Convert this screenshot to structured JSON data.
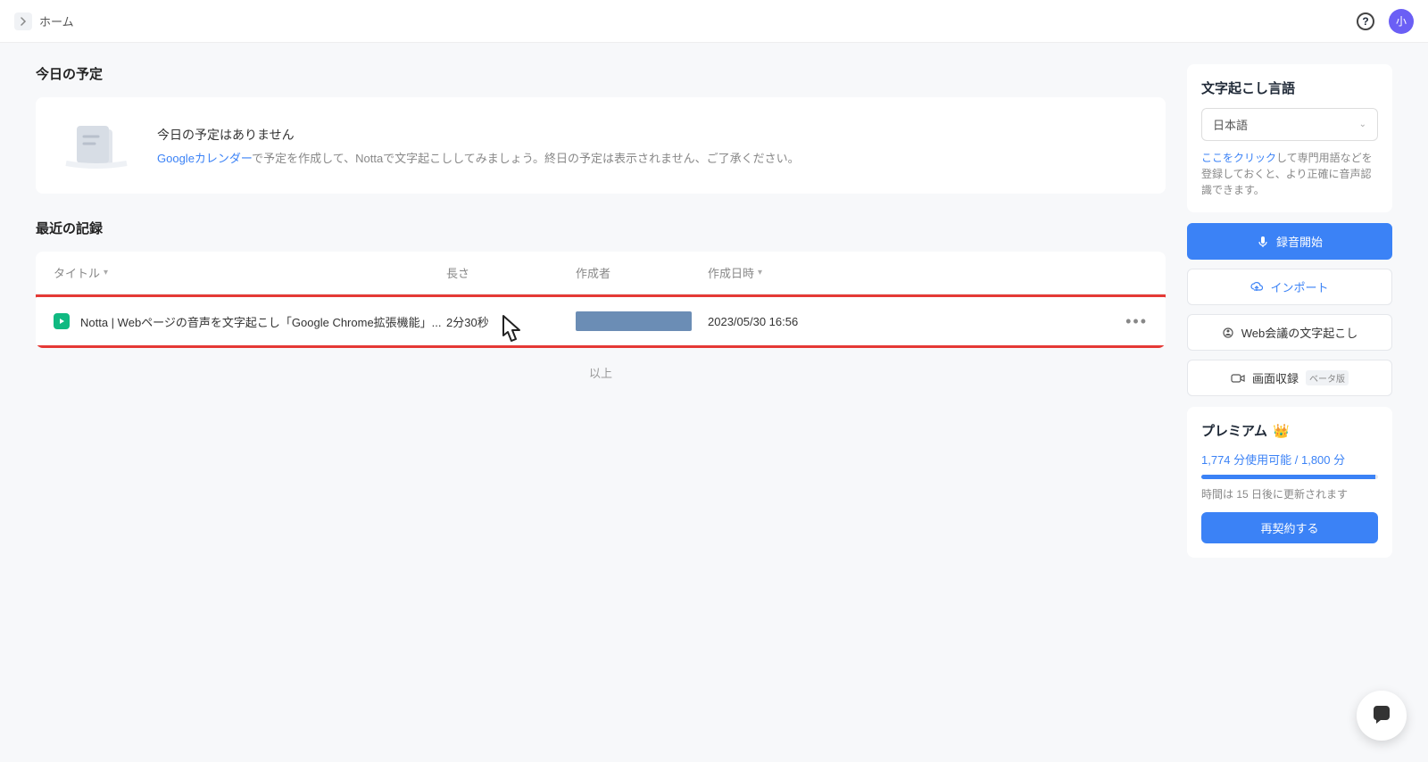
{
  "topbar": {
    "breadcrumb": "ホーム",
    "avatar_label": "小"
  },
  "schedule": {
    "section_title": "今日の予定",
    "empty_title": "今日の予定はありません",
    "empty_link": "Googleカレンダー",
    "empty_text_rest": "で予定を作成して、Nottaで文字起こししてみましょう。終日の予定は表示されません、ご了承ください。"
  },
  "records": {
    "section_title": "最近の記録",
    "columns": {
      "title": "タイトル",
      "duration": "長さ",
      "author": "作成者",
      "date": "作成日時"
    },
    "rows": [
      {
        "title": "Notta | Webページの音声を文字起こし「Google Chrome拡張機能」...",
        "duration": "2分30秒",
        "date": "2023/05/30 16:56"
      }
    ],
    "footer": "以上"
  },
  "language_panel": {
    "title": "文字起こし言語",
    "selected": "日本語",
    "hint_link": "ここをクリック",
    "hint_rest": "して専門用語などを登録しておくと、より正確に音声認識できます。"
  },
  "actions": {
    "record": "録音開始",
    "import": "インポート",
    "meeting": "Web会議の文字起こし",
    "screen": "画面収録",
    "beta": "ベータ版"
  },
  "premium": {
    "title": "プレミアム",
    "usage_used": 1774,
    "usage_total": 1800,
    "usage_text": "1,774 分使用可能 / 1,800 分",
    "note": "時間は 15 日後に更新されます",
    "renew_button": "再契約する"
  }
}
